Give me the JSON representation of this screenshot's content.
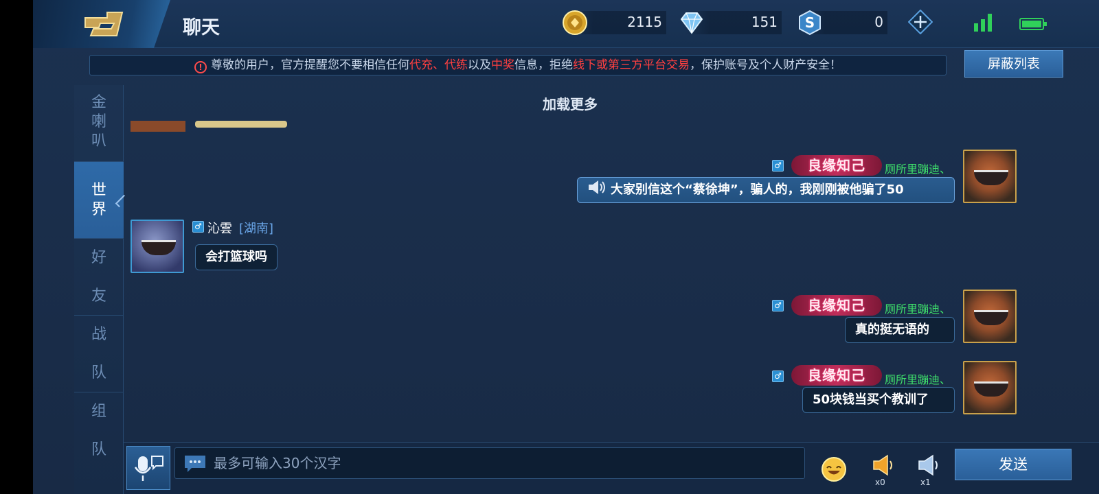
{
  "header": {
    "title": "聊天",
    "gold": "2115",
    "diamonds": "151",
    "points": "0"
  },
  "notice": {
    "parts": [
      {
        "text": "尊敬的用户，官方提醒您不要相信任何",
        "red": false
      },
      {
        "text": "代充、代练",
        "red": true
      },
      {
        "text": "以及",
        "red": false
      },
      {
        "text": "中奖",
        "red": true
      },
      {
        "text": "信息，拒绝",
        "red": false
      },
      {
        "text": "线下或第三方平台交易",
        "red": true
      },
      {
        "text": "，保护账号及个人财产安全！",
        "red": false
      }
    ],
    "block_list_label": "屏蔽列表"
  },
  "sidebar": {
    "tabs": [
      {
        "label": "金喇叭",
        "chars": [
          "金",
          "喇",
          "叭"
        ]
      },
      {
        "label": "世界",
        "chars": [
          "世",
          "界"
        ],
        "active": true
      },
      {
        "label": "好友",
        "chars": [
          "好",
          "友"
        ]
      },
      {
        "label": "战队",
        "chars": [
          "战",
          "队"
        ]
      },
      {
        "label": "组队",
        "chars": [
          "组",
          "队"
        ]
      }
    ]
  },
  "chat": {
    "load_more": "加载更多",
    "messages": [
      {
        "side": "right",
        "badge": "良缘知己",
        "name": "厕所里蹦迪、",
        "sex": "♂",
        "text": "大家别信这个“蔡徐坤”，骗人的，我刚刚被他骗了50",
        "horn": true
      },
      {
        "side": "left",
        "name": "沁雲",
        "region": "[湖南]",
        "sex": "♂",
        "text": "会打篮球吗"
      },
      {
        "side": "right",
        "badge": "良缘知己",
        "name": "厕所里蹦迪、",
        "sex": "♂",
        "text": "真的挺无语的"
      },
      {
        "side": "right",
        "badge": "良缘知己",
        "name": "厕所里蹦迪、",
        "sex": "♂",
        "text": "50块钱当买个教训了"
      }
    ]
  },
  "input": {
    "placeholder": "最多可输入30个汉字",
    "gold_horn_count": "x0",
    "blue_horn_count": "x1",
    "send_label": "发送"
  },
  "icons": [
    "back-arrow-icon",
    "gold-coin-icon",
    "diamond-icon",
    "s-points-icon",
    "plus-icon",
    "signal-icon",
    "battery-icon",
    "warning-icon",
    "speaker-icon",
    "microphone-icon",
    "chat-bubble-icon",
    "emoji-icon",
    "gold-horn-icon",
    "blue-horn-icon"
  ]
}
